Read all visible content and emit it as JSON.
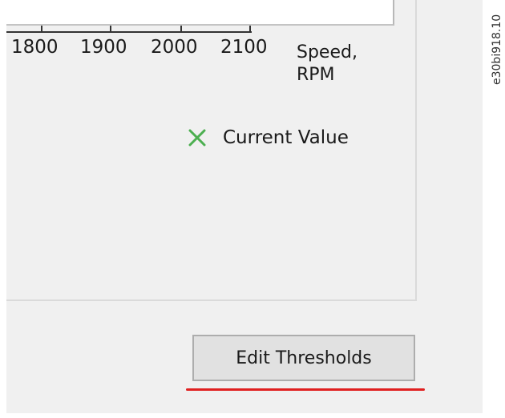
{
  "chart_data": {
    "type": "scatter",
    "xlabel": "Speed,\nRPM",
    "x_ticks": [
      "1800",
      "1900",
      "2000",
      "2100"
    ],
    "legend": [
      {
        "label": "Current Value",
        "marker": "x",
        "color": "#4caf50"
      }
    ]
  },
  "axis": {
    "title": "Speed,\nRPM",
    "ticks": [
      "1800",
      "1900",
      "2000",
      "2100"
    ]
  },
  "legend": {
    "current_value_label": "Current Value",
    "current_value_icon": "x-marker-icon",
    "current_value_color": "#4caf50"
  },
  "actions": {
    "edit_thresholds_label": "Edit Thresholds"
  },
  "highlight": {
    "color": "#e02020"
  },
  "figure": {
    "id": "e30bi918.10"
  }
}
